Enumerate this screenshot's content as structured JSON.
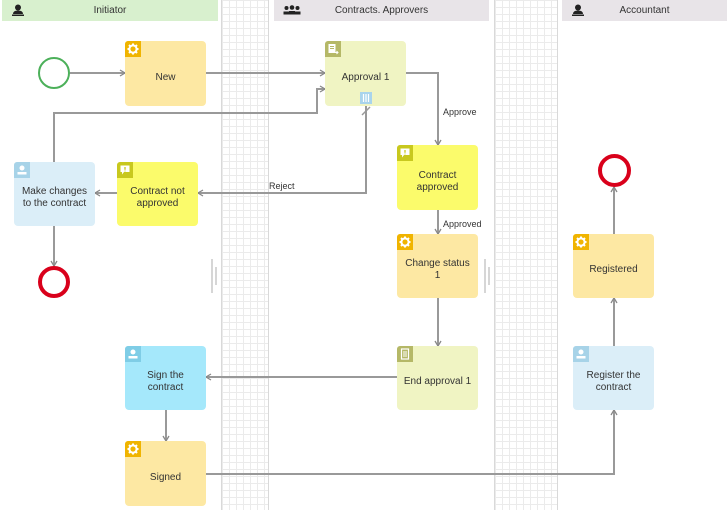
{
  "lanes": [
    {
      "title": "Initiator",
      "icon": "user-icon"
    },
    {
      "title": "Contracts. Approvers",
      "icon": "group-icon"
    },
    {
      "title": "Accountant",
      "icon": "user-icon"
    }
  ],
  "nodes": {
    "new": {
      "label": "New",
      "type": "script",
      "icon": "gear-icon"
    },
    "approval1": {
      "label": "Approval 1",
      "type": "approval",
      "icon": "document-arrow-icon"
    },
    "contract_not_approved": {
      "label": "Contract not approved",
      "type": "notification",
      "icon": "alert-comment-icon"
    },
    "make_changes": {
      "label": "Make changes to the contract",
      "type": "user-task",
      "icon": "user-icon"
    },
    "contract_approved": {
      "label": "Contract approved",
      "type": "notification",
      "icon": "alert-comment-icon"
    },
    "change_status1": {
      "label": "Change status 1",
      "type": "script",
      "icon": "gear-icon"
    },
    "end_approval1": {
      "label": "End approval 1",
      "type": "approval-end",
      "icon": "document-icon"
    },
    "sign_contract": {
      "label": "Sign the contract",
      "type": "user-task",
      "icon": "user-icon"
    },
    "signed": {
      "label": "Signed",
      "type": "script",
      "icon": "gear-icon"
    },
    "register_contract": {
      "label": "Register the contract",
      "type": "user-task",
      "icon": "user-icon"
    },
    "registered": {
      "label": "Registered",
      "type": "script",
      "icon": "gear-icon"
    }
  },
  "edge_labels": {
    "approve": "Approve",
    "reject": "Reject",
    "approved": "Approved"
  },
  "colors": {
    "start_event": "#4cb05a",
    "end_event": "#d9001b",
    "edge": "#999999"
  }
}
